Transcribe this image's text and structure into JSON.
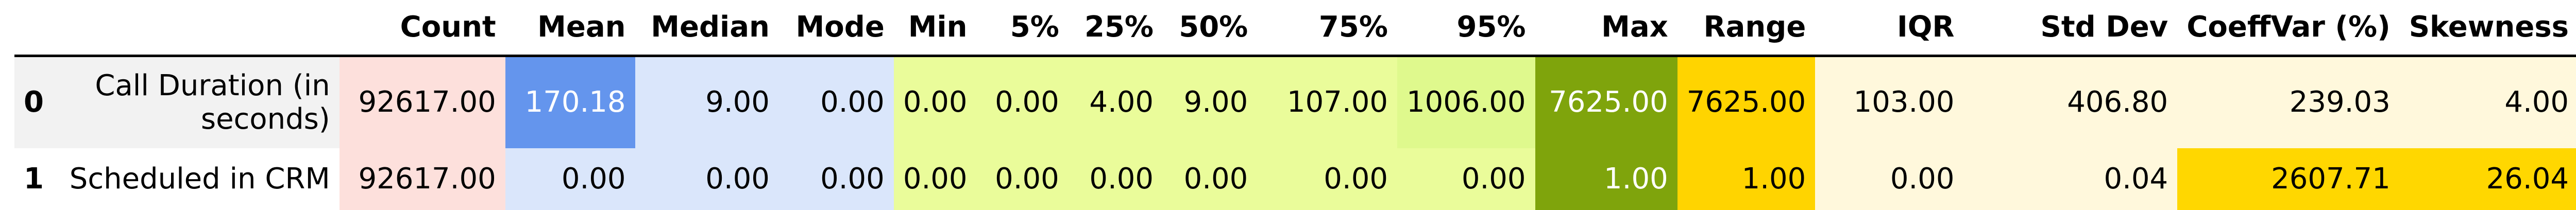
{
  "table": {
    "columns": [
      "Count",
      "Mean",
      "Median",
      "Mode",
      "Min",
      "5%",
      "25%",
      "50%",
      "75%",
      "95%",
      "Max",
      "Range",
      "IQR",
      "Std Dev",
      "CoeffVar (%)",
      "Skewness"
    ],
    "rows": [
      {
        "index": "0",
        "label": "Call Duration (in seconds)",
        "values": [
          "92617.00",
          "170.18",
          "9.00",
          "0.00",
          "0.00",
          "0.00",
          "4.00",
          "9.00",
          "107.00",
          "1006.00",
          "7625.00",
          "7625.00",
          "103.00",
          "406.80",
          "239.03",
          "4.00"
        ]
      },
      {
        "index": "1",
        "label": "Scheduled in CRM",
        "values": [
          "92617.00",
          "0.00",
          "0.00",
          "0.00",
          "0.00",
          "0.00",
          "0.00",
          "0.00",
          "0.00",
          "0.00",
          "1.00",
          "1.00",
          "0.00",
          "0.04",
          "2607.71",
          "26.04"
        ]
      }
    ],
    "cell_colors": [
      [
        "#fde0dc",
        "#6495ed",
        "#dae6fb",
        "#dae6fb",
        "#eafc9a",
        "#eafc9a",
        "#eafc9a",
        "#eafc9a",
        "#eafc9a",
        "#dff98d",
        "#7fa40c",
        "#ffd400",
        "#fff8dc",
        "#fff8dc",
        "#fff8dc",
        "#fff8dc"
      ],
      [
        "#fde0dc",
        "#dae6fb",
        "#dae6fb",
        "#dae6fb",
        "#eafc9a",
        "#eafc9a",
        "#eafc9a",
        "#eafc9a",
        "#eafc9a",
        "#eafc9a",
        "#7fa40c",
        "#ffd400",
        "#fff8dc",
        "#fff8dc",
        "#ffd700",
        "#ffd700"
      ]
    ],
    "light_text_cells": [
      [
        0,
        1
      ],
      [
        0,
        10
      ],
      [
        1,
        10
      ]
    ]
  }
}
